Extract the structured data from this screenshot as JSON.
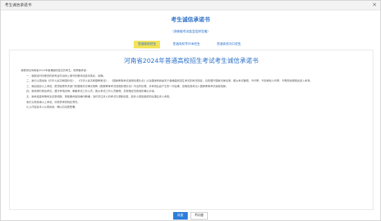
{
  "window": {
    "title": "考生诚信承诺书",
    "close_glyph": "×"
  },
  "header": {
    "title": "考生诚信承诺书",
    "subtitle": "（请根据考试类型选择签署）"
  },
  "tabs": [
    {
      "label": "普通高校招生",
      "active": true
    },
    {
      "label": "普通高校专升本招生",
      "active": false
    },
    {
      "label": "普通高校对口招生",
      "active": false
    }
  ],
  "document": {
    "title": "河南省2024年普通高校招生考试考生诚信承诺书",
    "paragraphs": [
      "我是参加河南省2024年普通高校招生的考生，现郑重承诺：",
      "一、我报名时所提供的所有证件及网上填写的基本信息均真实、准确。",
      "二、我已认真阅读《中华人民共和国刑法》、《中华人民共和国教育法》、《国家教育考试违规处理办法》以及国家和我省关于普通高校招生考试的有关规定，自觉遵守国家法律法规，服从考试管理，不作弊、不协助他人作弊，不携带违规物品进入考场。",
      "三、我如违反以上承诺，愿意接受有关部门依据相关法律法规和《国家教育考试违规处理办法》作出的处理，并承担由此产生的一切后果。违规信息将记入国家教育考试诚信档案。",
      "四、我将按时参加考试，遵守考场纪律，尊重考试工作人员，服从考试工作人员管理，并按规定完成相关确认手续。",
      "五、我承诺高考期间及志愿填报、录取期间保持通讯畅通，及时关注本人的考试与录取信息，因本人原因造成的后果由本人承担。",
      "我已认真阅读以上承诺，并愿意承担相应责任。",
      "以上内容由本人认真阅读、确认并自愿签署。"
    ]
  },
  "footer": {
    "confirm_label": "同意",
    "cancel_label": "不同意"
  }
}
